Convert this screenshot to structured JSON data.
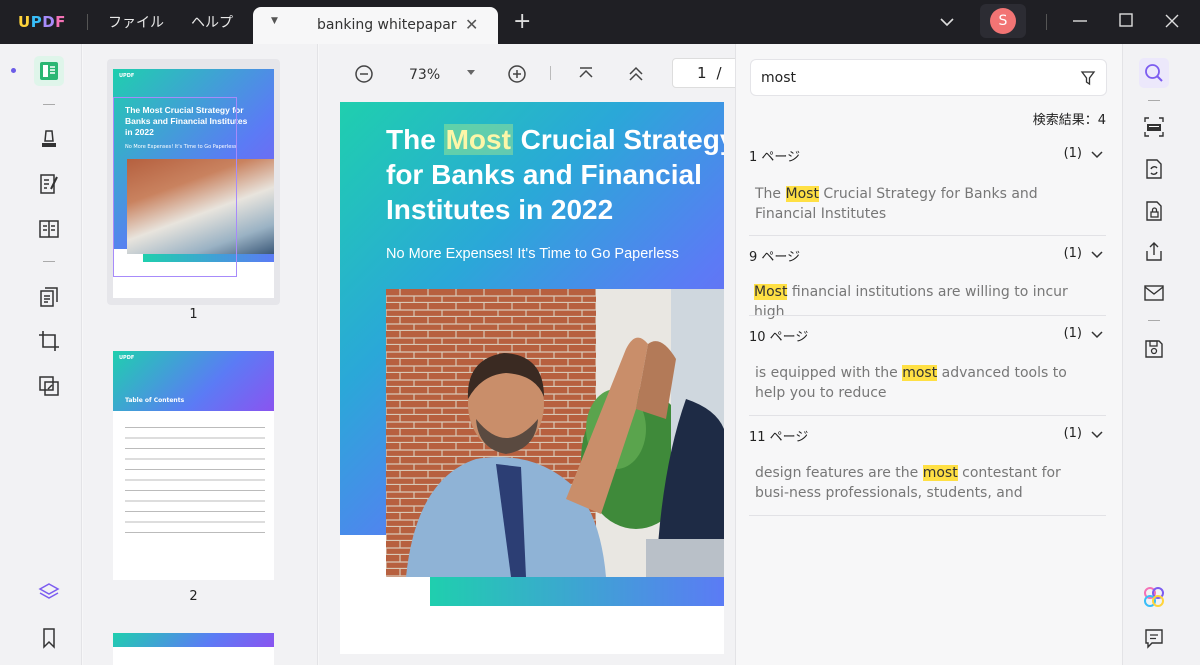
{
  "app": {
    "logo": "UPDF",
    "menu": [
      "ファイル",
      "ヘルプ"
    ],
    "tab_title": "banking whitepapar",
    "avatar_initial": "S"
  },
  "viewer": {
    "zoom": "73%",
    "current_page": "1",
    "page_separator": "/"
  },
  "thumbnails": [
    {
      "label": "1"
    },
    {
      "label": "2"
    }
  ],
  "thumb_text": {
    "p1_title": "The Most Crucial Strategy for Banks and Financial Institutes in 2022",
    "p1_sub": "No More Expenses! It's Time to Go Paperless",
    "p2_title": "Table of Contents",
    "brand": "UPDF"
  },
  "document": {
    "title_before": "The ",
    "title_highlight": "Most",
    "title_after": " Crucial Strategy for Banks and Financial Institutes in 2022",
    "subtitle": "No More Expenses! It's Time to Go Paperless"
  },
  "search": {
    "query": "most",
    "results_label": "検索結果：4",
    "results": [
      {
        "page": "1 ページ",
        "count": "(1)",
        "before": "The ",
        "match": "Most",
        "after": " Crucial Strategy for Banks and Financial Institutes"
      },
      {
        "page": "9 ページ",
        "count": "(1)",
        "before": "",
        "match": "Most",
        "after": " financial institutions are willing to incur high"
      },
      {
        "page": "10 ページ",
        "count": "(1)",
        "before": "is equipped with the ",
        "match": "most",
        "after": " advanced tools to help you to reduce"
      },
      {
        "page": "11 ページ",
        "count": "(1)",
        "before": "design features are the ",
        "match": "most",
        "after": " contestant for busi-ness professionals, students, and"
      }
    ]
  },
  "colors": {
    "accent_green": "#2bb673",
    "accent_purple": "#7c5cf0",
    "highlight": "#ffe044",
    "titlebar": "#1f1f24"
  }
}
